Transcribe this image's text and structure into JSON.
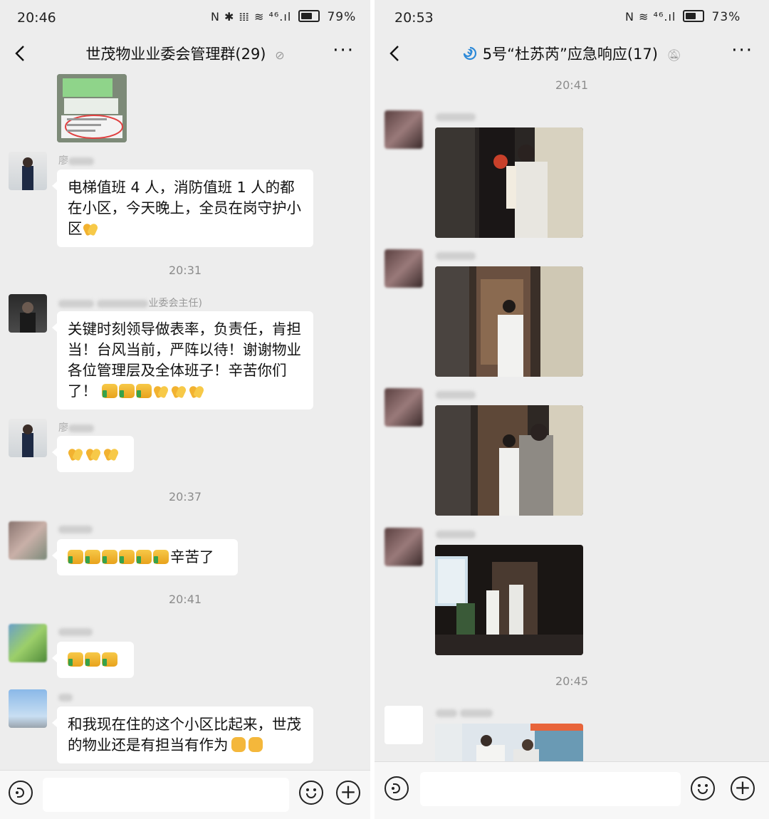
{
  "left": {
    "status": {
      "time": "20:46",
      "icons": "N ✱ 𝍖 ≋ ⁴⁶.ıl",
      "battery": "79%",
      "battery_level": 0.79
    },
    "title": "世茂物业业委会管理群(29)",
    "messages": [
      {
        "sender_suffix": "",
        "text": "电梯值班 4 人，消防值班 1 人的都在小区，今天晚上，全员在岗守护小区"
      },
      {
        "sender_suffix": "业委会主任)",
        "text": "关键时刻领导做表率，负责任，肯担当！台风当前，严阵以待！谢谢物业各位管理层及全体班子！辛苦你们了！"
      },
      {
        "sender_suffix": "",
        "text": ""
      },
      {
        "sender_suffix": "",
        "text": "辛苦了"
      },
      {
        "sender_suffix": "",
        "text": ""
      },
      {
        "sender_suffix": "",
        "text": "和我现在住的这个小区比起来，世茂的物业还是有担当有作为"
      }
    ],
    "timestamps": [
      "20:31",
      "20:37",
      "20:41"
    ]
  },
  "right": {
    "status": {
      "time": "20:53",
      "icons": "N ≋ ⁴⁶.ıl",
      "battery": "73%",
      "battery_level": 0.73
    },
    "title": "5号“杜苏芮”应急响应(17)",
    "timestamps": [
      "20:41",
      "20:45"
    ]
  },
  "icons": {
    "back": "chevron-left-icon",
    "more": "more-dots-icon",
    "mute": "mute-bell-icon",
    "voice": "voice-icon",
    "emoji": "emoji-icon",
    "plus": "plus-icon",
    "typhoon": "typhoon-icon"
  },
  "colors": {
    "background": "#ededed",
    "bubble": "#ffffff",
    "timestamp": "#8c8c8c"
  }
}
